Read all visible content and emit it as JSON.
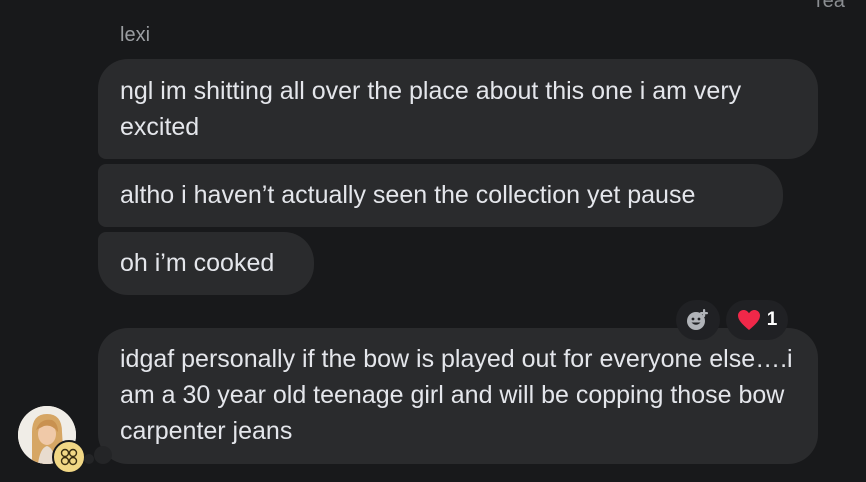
{
  "header": {
    "top_fragment": "rea"
  },
  "thread": {
    "sender_name": "lexi",
    "messages": [
      {
        "text": "ngl im shitting all over the place about this one i am very excited"
      },
      {
        "text": "altho i haven’t actually seen the collection yet pause"
      },
      {
        "text": "oh i’m cooked"
      },
      {
        "text": "idgaf personally if the bow is played out for everyone else….i am a 30 year old teenage girl and will be copping those bow carpenter jeans"
      }
    ],
    "reactions": {
      "add_reaction_icon": "add-emoji-icon",
      "heart": {
        "icon": "red-heart-icon",
        "count": "1",
        "color": "#f02849"
      }
    }
  },
  "colors": {
    "background": "#18191b",
    "bubble": "#2a2b2d",
    "text": "#e4e6eb",
    "sender": "#9a9da1"
  }
}
